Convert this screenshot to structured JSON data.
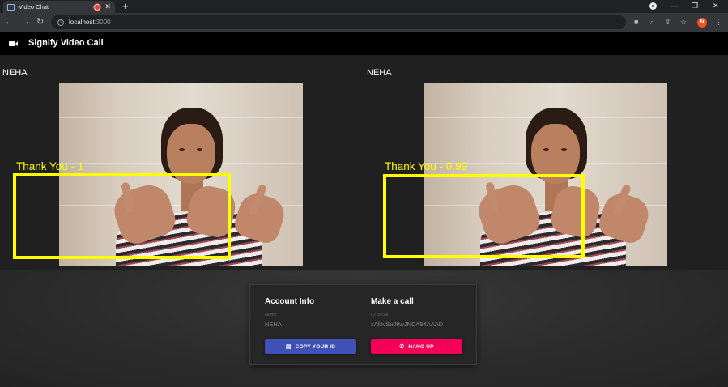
{
  "browser": {
    "tab_title": "Video Chat",
    "tab_close": "✕",
    "new_tab": "+",
    "url_host": "localhost",
    "url_port": ":3000",
    "profile_initial": "N",
    "window_minimize": "—",
    "window_restore": "❐",
    "window_close": "✕"
  },
  "app": {
    "title": "Signify Video Call"
  },
  "videos": [
    {
      "user_name": "NEHA",
      "detection_label": "Thank You - 1"
    },
    {
      "user_name": "NEHA",
      "detection_label": "Thank You - 0.99"
    }
  ],
  "panel": {
    "account_heading": "Account Info",
    "name_label": "Name",
    "name_value": "NEHA",
    "copy_button": "COPY YOUR ID",
    "call_heading": "Make a call",
    "id_label": "ID to call",
    "id_value": "zAfzvSuJ8wJNCA94AAAD",
    "hangup_button": "HANG UP"
  },
  "colors": {
    "detection": "#ffff00",
    "copy_button": "#3f51b5",
    "hangup_button": "#f50057"
  },
  "icons": [
    "camera-icon",
    "clipboard-icon",
    "phone-hangup-icon"
  ]
}
